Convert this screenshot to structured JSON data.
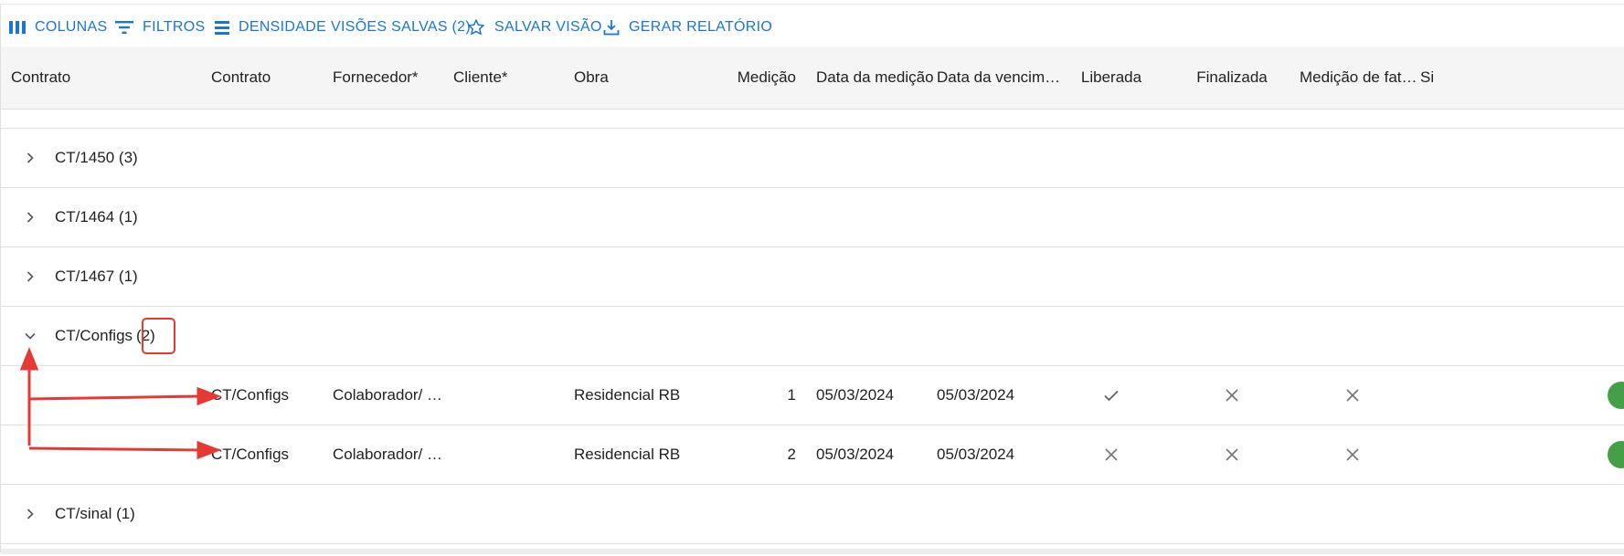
{
  "toolbar": {
    "columns_label": "COLUNAS",
    "filters_label": "FILTROS",
    "density_label": "DENSIDADE",
    "saved_views_label": "VISÕES SALVAS (2)",
    "save_view_label": "SALVAR VISÃO",
    "report_label": "GERAR RELATÓRIO"
  },
  "headers": {
    "group": "Contrato",
    "contract": "Contrato",
    "supplier": "Fornecedor*",
    "client": "Cliente*",
    "project": "Obra",
    "measurement": "Medição",
    "measurement_date": "Data da medição",
    "due_date": "Data da vencim…",
    "released": "Liberada",
    "finished": "Finalizada",
    "billing": "Medição de fat…",
    "last": "Si"
  },
  "groups": [
    {
      "label": "CT/1450 (3)"
    },
    {
      "label": "CT/1464 (1)"
    },
    {
      "label": "CT/1467 (1)"
    },
    {
      "label": "CT/Configs",
      "count": "(2)"
    },
    {
      "label": "CT/sinal (1)"
    }
  ],
  "rows": [
    {
      "contract": "CT/Configs",
      "supplier": "Colaborador/ …",
      "client": "",
      "project": "Residencial RB",
      "measurement": "1",
      "measurement_date": "05/03/2024",
      "due_date": "05/03/2024",
      "released": "check-icon",
      "finished": "close-icon",
      "billing": "close-icon"
    },
    {
      "contract": "CT/Configs",
      "supplier": "Colaborador/ …",
      "client": "",
      "project": "Residencial RB",
      "measurement": "2",
      "measurement_date": "05/03/2024",
      "due_date": "05/03/2024",
      "released": "close-icon",
      "finished": "close-icon",
      "billing": "close-icon"
    }
  ],
  "colors": {
    "accent": "#1976d2",
    "annotation": "#e53935",
    "status_green": "#43a047",
    "header_bg": "#f5f5f5"
  }
}
